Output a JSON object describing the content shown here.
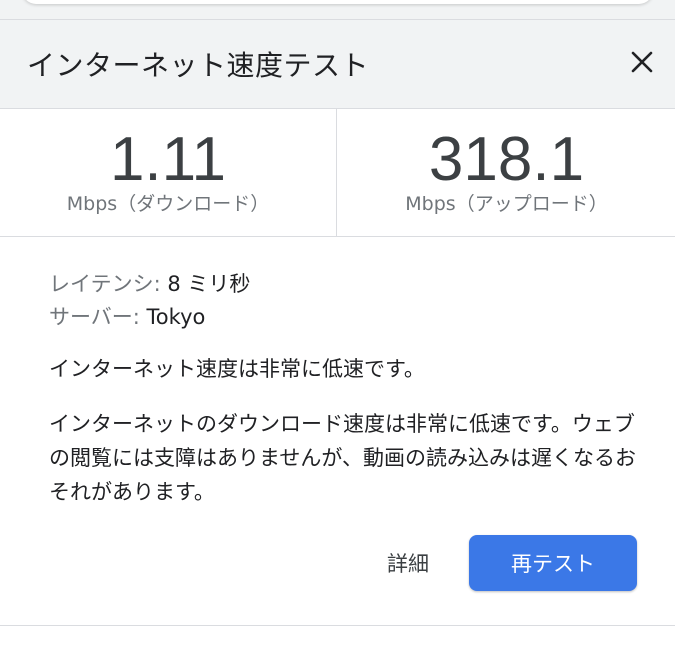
{
  "header": {
    "title": "インターネット速度テスト",
    "close_icon": "close-icon"
  },
  "speeds": {
    "download": {
      "value": "1.11",
      "unit": "Mbps（ダウンロード）"
    },
    "upload": {
      "value": "318.1",
      "unit": "Mbps（アップロード）"
    }
  },
  "stats": {
    "latency_label": "レイテンシ: ",
    "latency_value": "8 ミリ秒",
    "server_label": "サーバー: ",
    "server_value": "Tokyo"
  },
  "messages": {
    "summary": "インターネット速度は非常に低速です。",
    "detail": "インターネットのダウンロード速度は非常に低速です。ウェブの閲覧には支障はありませんが、動画の読み込みは遅くなるおそれがあります。"
  },
  "actions": {
    "details_label": "詳細",
    "retest_label": "再テスト"
  },
  "colors": {
    "accent": "#3b78e7",
    "header_bg": "#f1f3f4",
    "muted_text": "#70757a",
    "divider": "#dadce0"
  }
}
